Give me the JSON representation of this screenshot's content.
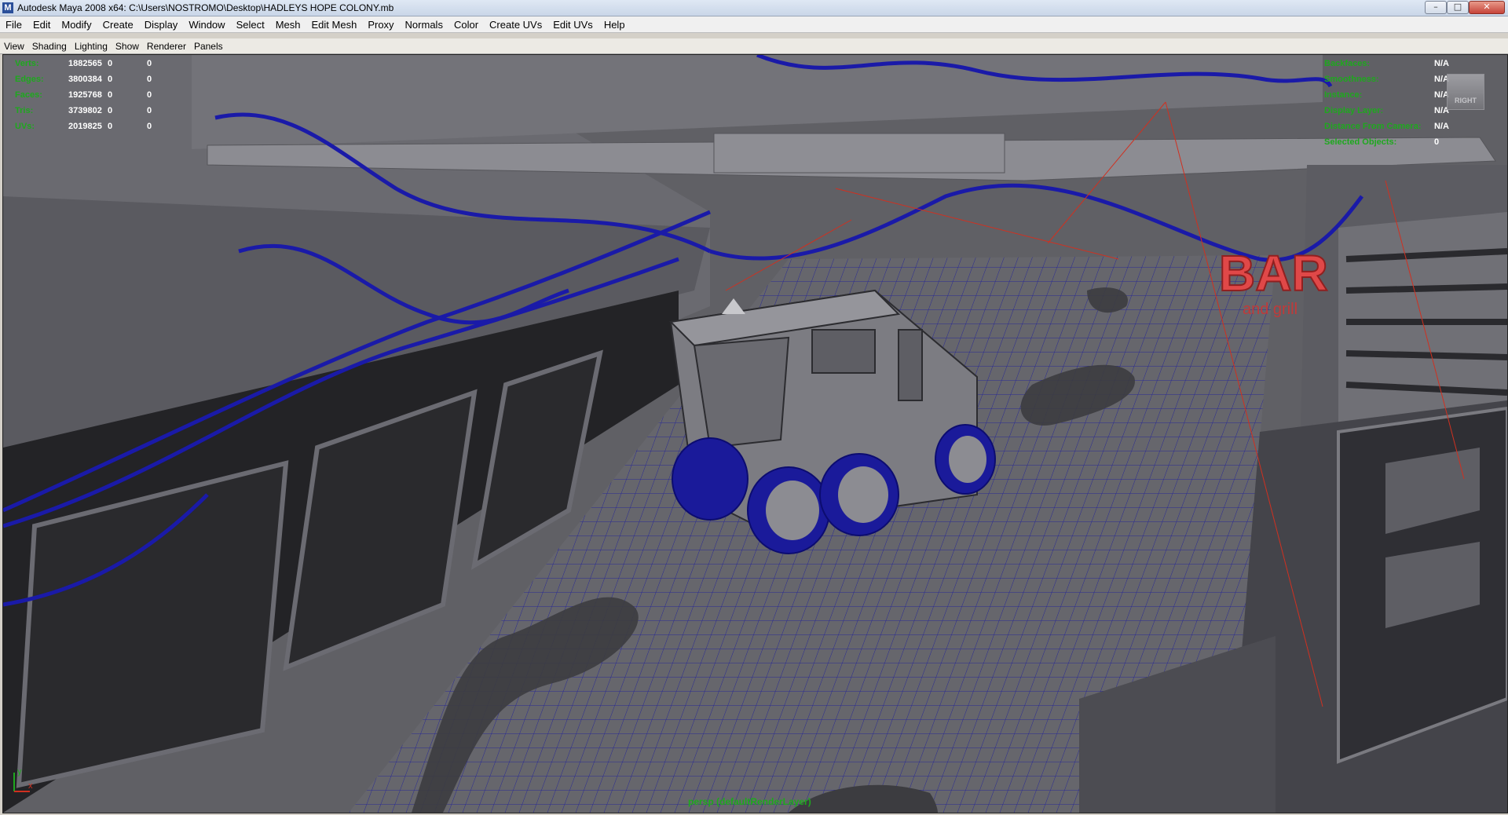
{
  "window": {
    "title": "Autodesk Maya 2008 x64: C:\\Users\\NOSTROMO\\Desktop\\HADLEYS HOPE COLONY.mb",
    "controls": [
      "–",
      "□",
      "✕"
    ]
  },
  "menubar": [
    "File",
    "Edit",
    "Modify",
    "Create",
    "Display",
    "Window",
    "Select",
    "Mesh",
    "Edit Mesh",
    "Proxy",
    "Normals",
    "Color",
    "Create UVs",
    "Edit UVs",
    "Help"
  ],
  "panel_menu": [
    "View",
    "Shading",
    "Lighting",
    "Show",
    "Renderer",
    "Panels"
  ],
  "hud_left": [
    {
      "label": "Verts:",
      "v1": "1882565",
      "v2": "0",
      "v3": "0"
    },
    {
      "label": "Edges:",
      "v1": "3800384",
      "v2": "0",
      "v3": "0"
    },
    {
      "label": "Faces:",
      "v1": "1925768",
      "v2": "0",
      "v3": "0"
    },
    {
      "label": "Tris:",
      "v1": "3739802",
      "v2": "0",
      "v3": "0"
    },
    {
      "label": "UVs:",
      "v1": "2019825",
      "v2": "0",
      "v3": "0"
    }
  ],
  "hud_right": [
    {
      "label": "Backfaces:",
      "value": "N/A"
    },
    {
      "label": "Smoothness:",
      "value": "N/A"
    },
    {
      "label": "Instance:",
      "value": "N/A"
    },
    {
      "label": "Display Layer:",
      "value": "N/A"
    },
    {
      "label": "Distance From Camera:",
      "value": "N/A"
    },
    {
      "label": "Selected Objects:",
      "value": "0"
    }
  ],
  "view_cube_label": "RIGHT",
  "render_layer_label": "persp (defaultRenderLayer)",
  "scene_sign": {
    "main": "BAR",
    "sub": "and grill"
  },
  "axis": {
    "x": "x",
    "y": "y"
  },
  "colors": {
    "hud_label": "#1ea81e",
    "wire": "#1a1aa8",
    "wire_red": "#d03020",
    "viewport_bg": "#5d5d62"
  }
}
